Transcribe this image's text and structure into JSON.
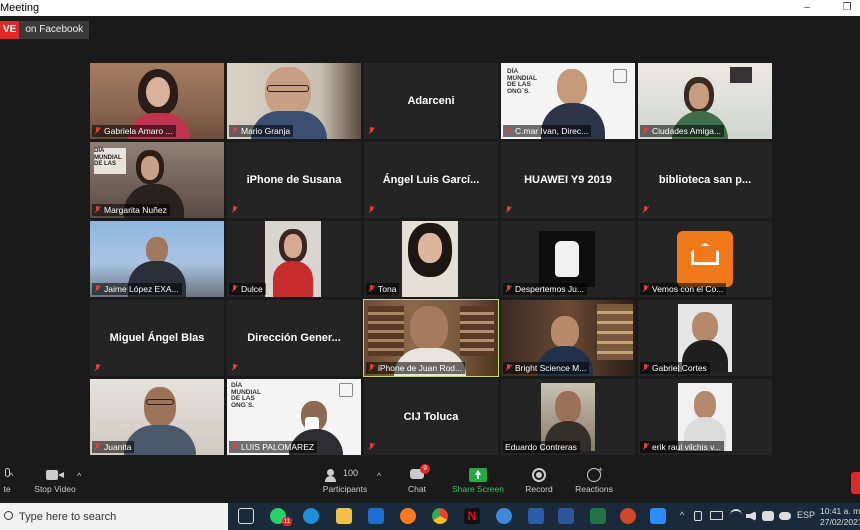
{
  "window": {
    "title": "Meeting",
    "minimize": "–",
    "restore": "❐"
  },
  "live": {
    "badge": "VE",
    "platform": "on Facebook"
  },
  "participants": [
    {
      "name": "Gabriela Amaro ...",
      "type": "video"
    },
    {
      "name": "Mario Granja",
      "type": "video"
    },
    {
      "name": "Adarceni",
      "type": "name"
    },
    {
      "name": "C.mar Ivan, Direc...",
      "type": "video"
    },
    {
      "name": "Ciudades Amiga...",
      "type": "video"
    },
    {
      "name": "Margarita Nuñez",
      "type": "video"
    },
    {
      "name": "iPhone de Susana",
      "type": "name"
    },
    {
      "name": "Ángel Luis Garcí...",
      "type": "name"
    },
    {
      "name": "HUAWEI Y9 2019",
      "type": "name"
    },
    {
      "name": "biblioteca san p...",
      "type": "name"
    },
    {
      "name": "Jaime López EXA...",
      "type": "video"
    },
    {
      "name": "Dulce",
      "type": "video"
    },
    {
      "name": "Tona",
      "type": "video"
    },
    {
      "name": "Despertemos Ju...",
      "type": "video"
    },
    {
      "name": "Vemos con el Co...",
      "type": "video"
    },
    {
      "name": "Miguel Ángel Blas",
      "type": "name"
    },
    {
      "name": "Dirección Gener...",
      "type": "name"
    },
    {
      "name": "iPhone de Juan Rod...",
      "type": "video",
      "active": true
    },
    {
      "name": "Bright Science M...",
      "type": "video"
    },
    {
      "name": "Gabriel Cortes",
      "type": "video"
    },
    {
      "name": "Juanita",
      "type": "video"
    },
    {
      "name": "LUIS PALOMAREZ",
      "type": "video"
    },
    {
      "name": "CIJ Toluca",
      "type": "name"
    },
    {
      "name": "Eduardo Contreras",
      "type": "video"
    },
    {
      "name": "erik raul vilchis v...",
      "type": "video"
    }
  ],
  "toolbar": {
    "mute_label": "te",
    "video_label": "Stop Video",
    "participants_label": "Participants",
    "participants_count": "100",
    "chat_label": "Chat",
    "chat_badge": "9",
    "share_label": "Share Screen",
    "record_label": "Record",
    "reactions_label": "Reactions"
  },
  "taskbar": {
    "search_placeholder": "Type here to search",
    "whatsapp_badge": "11",
    "language": "ESP",
    "time": "10:41 a. m.",
    "date": "27/02/2021"
  }
}
